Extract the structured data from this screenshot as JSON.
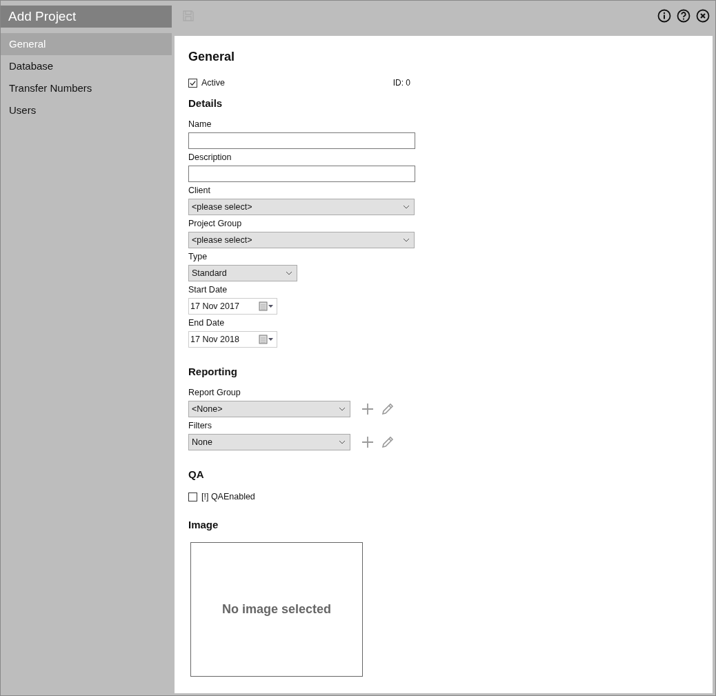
{
  "window": {
    "title": "Add Project"
  },
  "sidebar": {
    "items": [
      {
        "label": "General",
        "selected": true
      },
      {
        "label": "Database",
        "selected": false
      },
      {
        "label": "Transfer Numbers",
        "selected": false
      },
      {
        "label": "Users",
        "selected": false
      }
    ]
  },
  "general": {
    "heading": "General",
    "active": {
      "label": "Active",
      "checked": true
    },
    "id_text": "ID: 0"
  },
  "details": {
    "heading": "Details",
    "fields": [
      {
        "kind": "text",
        "label": "Name"
      },
      {
        "kind": "text",
        "label": "Description"
      },
      {
        "kind": "select",
        "label": "Client",
        "value": "<please select>"
      },
      {
        "kind": "select",
        "label": "Project Group",
        "value": "<please select>"
      },
      {
        "kind": "select-short",
        "label": "Type",
        "value": "Standard"
      },
      {
        "kind": "date",
        "label": "Start Date",
        "value": "17 Nov 2017"
      },
      {
        "kind": "date",
        "label": "End Date",
        "value": "17 Nov 2018"
      }
    ]
  },
  "reporting": {
    "heading": "Reporting",
    "fields": [
      {
        "kind": "select-actions",
        "label": "Report Group",
        "value": "<None>"
      },
      {
        "kind": "select-actions",
        "label": "Filters",
        "value": "None"
      }
    ]
  },
  "qa": {
    "heading": "QA",
    "checkbox": {
      "label": "[!] QAEnabled",
      "checked": false
    }
  },
  "image": {
    "heading": "Image",
    "placeholder": "No image selected"
  }
}
